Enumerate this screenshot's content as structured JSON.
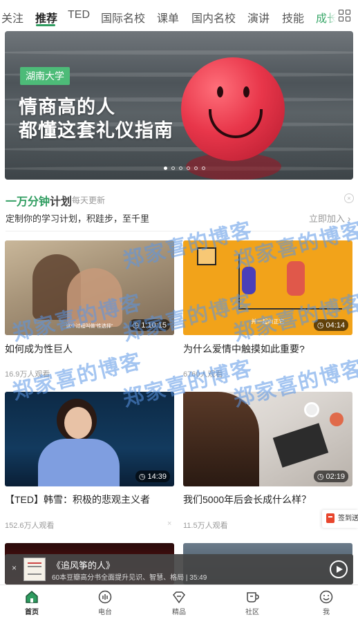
{
  "tabs": [
    {
      "label": "关注"
    },
    {
      "label": "推荐",
      "active": true
    },
    {
      "label": "TED"
    },
    {
      "label": "国际名校"
    },
    {
      "label": "课单"
    },
    {
      "label": "国内名校"
    },
    {
      "label": "演讲"
    },
    {
      "label": "技能"
    },
    {
      "label": "成长"
    }
  ],
  "banner": {
    "tag": "湖南大学",
    "title_line1": "情商高的人",
    "title_line2": "都懂这套礼仪指南",
    "page_count": 6,
    "active_page": 1
  },
  "plan": {
    "title_prefix": "一万分钟",
    "title_suffix": "计划",
    "subtitle": "每天更新",
    "description": "定制你的学习计划，积跬步，至千里",
    "join_label": "立即加入",
    "join_arrow": "›"
  },
  "cards": [
    {
      "title": "如何成为性巨人",
      "views": "16.9万人观看",
      "duration": "1:10:15",
      "subtitle": "这个过程叫做“性选择”"
    },
    {
      "title": "为什么爱情中触摸如此重要?",
      "views": "6760人观看",
      "duration": "04:14",
      "subtitle": "并一起纠正它"
    },
    {
      "title": "【TED】韩雪：积极的悲观主义者",
      "views": "152.6万人观看",
      "duration": "14:39"
    },
    {
      "title": "我们5000年后会长成什么样？",
      "views": "11.5万人观看",
      "duration": "02:19"
    }
  ],
  "watermark": "郑家喜的博客",
  "player": {
    "title": "《追风筝的人》",
    "subtitle": "60本豆瓣高分书全面提升见识、智慧、格局 | 35:49",
    "close": "×"
  },
  "signin": {
    "label": "签到送"
  },
  "nav": [
    {
      "label": "首页",
      "icon": "home-icon",
      "active": true
    },
    {
      "label": "电台",
      "icon": "radio-icon"
    },
    {
      "label": "精品",
      "icon": "diamond-icon"
    },
    {
      "label": "社区",
      "icon": "cup-icon"
    },
    {
      "label": "我",
      "icon": "profile-icon"
    }
  ],
  "colors": {
    "accent": "#2e9c5f",
    "banner_tag": "#4dbb78",
    "orange_card": "#f2a31a",
    "signin_red": "#e8452c"
  }
}
